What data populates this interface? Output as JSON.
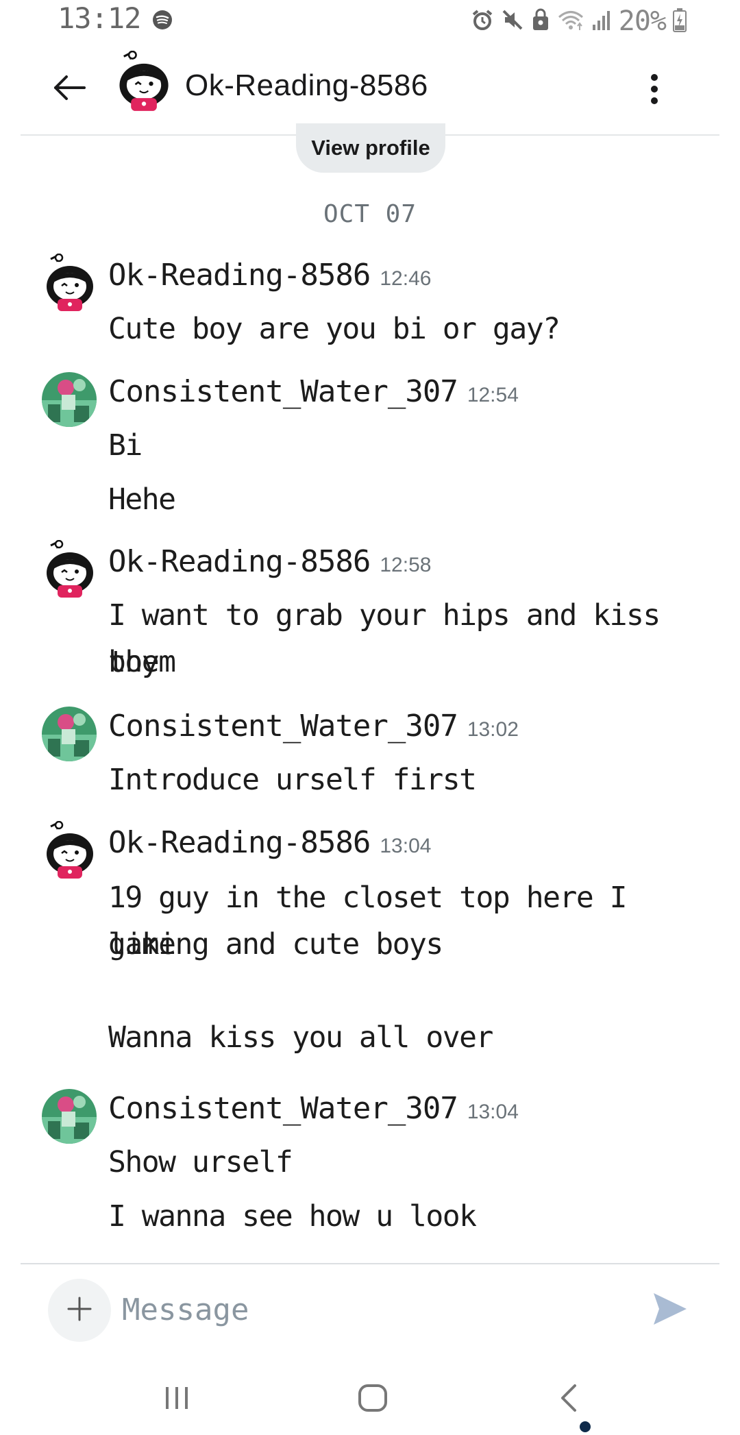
{
  "status_bar": {
    "time": "13:12",
    "battery": "20%",
    "icons": [
      "spotify-icon",
      "alarm-icon",
      "mute-icon",
      "lock-badge-icon",
      "wifi-icon",
      "signal-icon",
      "battery-charging-icon"
    ]
  },
  "header": {
    "title": "Ok-Reading-8586",
    "back_icon": "arrow-left-icon",
    "more_icon": "more-vertical-icon"
  },
  "view_profile_label": "View profile",
  "date_divider": "OCT 07",
  "messages": [
    {
      "author": "Ok-Reading-8586",
      "time": "12:46",
      "avatar": "snoo-girl",
      "lines": [
        "Cute boy are you bi or gay?"
      ]
    },
    {
      "author": "Consistent_Water_307",
      "time": "12:54",
      "avatar": "green-photo",
      "lines": [
        "Bi",
        "Hehe"
      ]
    },
    {
      "author": "Ok-Reading-8586",
      "time": "12:58",
      "avatar": "snoo-girl",
      "lines": [
        "I want to grab your hips and kiss them",
        "boy"
      ]
    },
    {
      "author": "Consistent_Water_307",
      "time": "13:02",
      "avatar": "green-photo",
      "lines": [
        "Introduce urself first"
      ]
    },
    {
      "author": "Ok-Reading-8586",
      "time": "13:04",
      "avatar": "snoo-girl",
      "lines": [
        "19 guy in the closet top here I like",
        "gaming and cute boys",
        "Wanna kiss you all over"
      ]
    },
    {
      "author": "Consistent_Water_307",
      "time": "13:04",
      "avatar": "green-photo",
      "lines": [
        "Show urself",
        "I wanna see how u look"
      ]
    }
  ],
  "composer": {
    "placeholder": "Message",
    "value": "",
    "plus_icon": "plus-icon",
    "send_icon": "send-icon"
  },
  "nav": {
    "recents_icon": "recents-icon",
    "home_icon": "home-icon",
    "back_icon": "nav-back-icon"
  },
  "colors": {
    "accent_send": "#a9bbd3",
    "pill_bg": "#e8ebed",
    "muted_text": "#6a7278",
    "snoo_shirt": "#e0245e",
    "photo_green": "#3e9a6b"
  }
}
